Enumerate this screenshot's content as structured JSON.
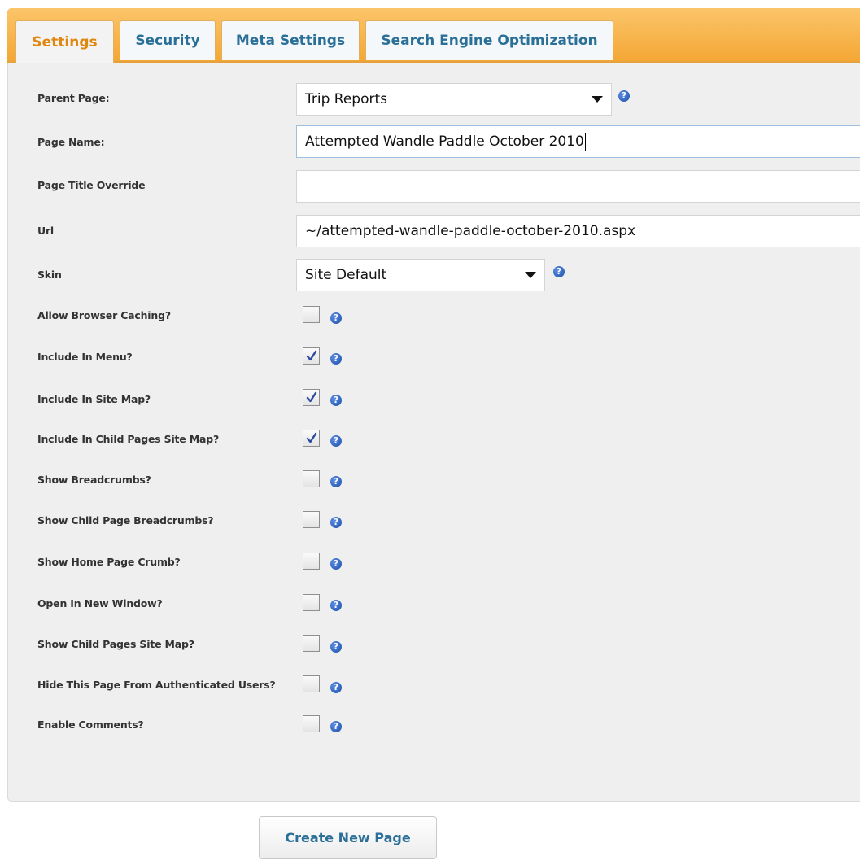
{
  "tabs": [
    {
      "label": "Settings",
      "active": true
    },
    {
      "label": "Security",
      "active": false
    },
    {
      "label": "Meta Settings",
      "active": false
    },
    {
      "label": "Search Engine Optimization",
      "active": false
    }
  ],
  "form": {
    "parent_page": {
      "label": "Parent Page:",
      "value": "Trip Reports"
    },
    "page_name": {
      "label": "Page Name:",
      "value": "Attempted Wandle Paddle October 2010"
    },
    "page_title_override": {
      "label": "Page Title Override",
      "value": ""
    },
    "url": {
      "label": "Url",
      "value": "~/attempted-wandle-paddle-october-2010.aspx"
    },
    "skin": {
      "label": "Skin",
      "value": "Site Default"
    },
    "options": [
      {
        "label": "Allow Browser Caching?",
        "checked": false
      },
      {
        "label": "Include In Menu?",
        "checked": true
      },
      {
        "label": "Include In Site Map?",
        "checked": true
      },
      {
        "label": "Include In Child Pages Site Map?",
        "checked": true
      },
      {
        "label": "Show Breadcrumbs?",
        "checked": false
      },
      {
        "label": "Show Child Page Breadcrumbs?",
        "checked": false
      },
      {
        "label": "Show Home Page Crumb?",
        "checked": false
      },
      {
        "label": "Open In New Window?",
        "checked": false
      },
      {
        "label": "Show Child Pages Site Map?",
        "checked": false
      },
      {
        "label": "Hide This Page From Authenticated Users?",
        "checked": false
      },
      {
        "label": "Enable Comments?",
        "checked": false
      }
    ]
  },
  "help_glyph": "?",
  "icons": {
    "help": "help-icon",
    "check": "checkmark-icon",
    "dropdown": "chevron-down-icon"
  },
  "colors": {
    "accent_orange": "#f4a735",
    "tab_text": "#2a6f97",
    "active_tab_text": "#e0870f",
    "help_blue": "#1d4fa8"
  },
  "actions": {
    "create_label": "Create New Page"
  }
}
